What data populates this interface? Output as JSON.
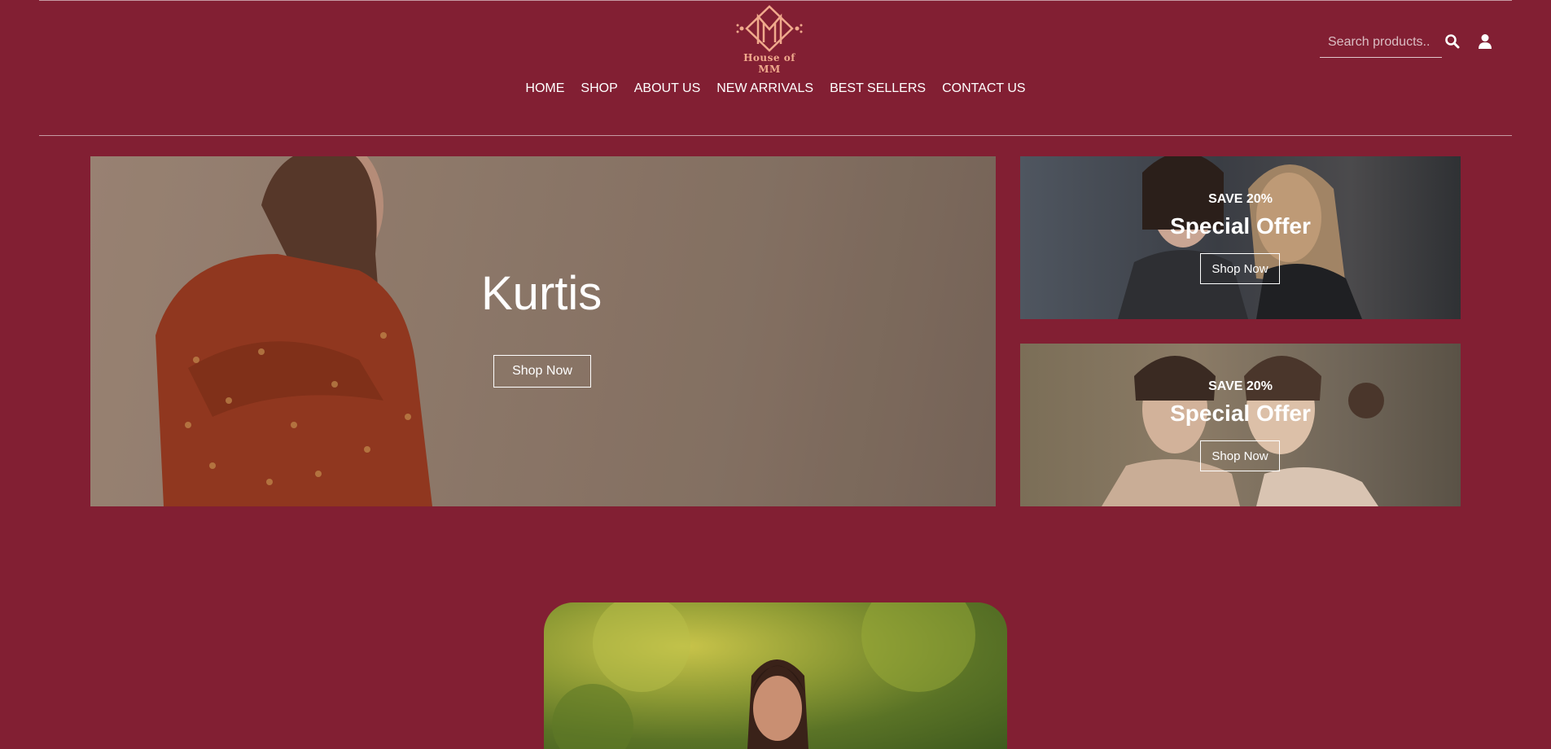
{
  "brand": {
    "logo_text": "House of MM"
  },
  "nav": {
    "items": [
      "HOME",
      "SHOP",
      "ABOUT US",
      "NEW ARRIVALS",
      "BEST SELLERS",
      "CONTACT US"
    ]
  },
  "search": {
    "placeholder": "Search products.."
  },
  "hero": {
    "title": "Kurtis",
    "button": "Shop Now"
  },
  "promos": [
    {
      "kicker": "SAVE 20%",
      "title": "Special Offer",
      "button": "Shop Now"
    },
    {
      "kicker": "SAVE 20%",
      "title": "Special Offer",
      "button": "Shop Now"
    }
  ],
  "colors": {
    "background": "#821f33",
    "logo_accent": "#f0a98c",
    "text": "#ffffff"
  }
}
